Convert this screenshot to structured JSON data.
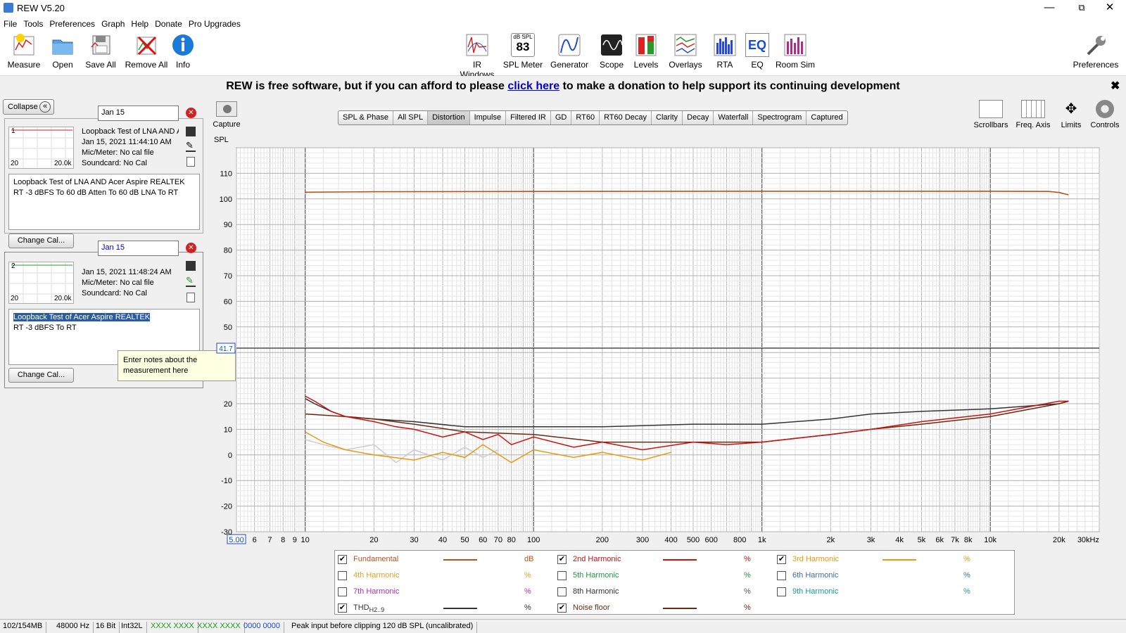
{
  "window": {
    "title": "REW V5.20"
  },
  "menu": [
    "File",
    "Tools",
    "Preferences",
    "Graph",
    "Help",
    "Donate",
    "Pro Upgrades"
  ],
  "toolbar_left": [
    "Measure",
    "Open",
    "Save All",
    "Remove All",
    "Info"
  ],
  "toolbar_center": [
    "IR Windows",
    "SPL Meter",
    "Generator",
    "Scope",
    "Levels",
    "Overlays",
    "RTA",
    "EQ",
    "Room Sim"
  ],
  "spl_meter_top": "dB SPL",
  "spl_meter_value": "83",
  "toolbar_right": "Preferences",
  "banner": {
    "pre": "REW is free software, but if you can afford to please ",
    "link": "click here",
    "post": " to make a donation to help support its continuing development"
  },
  "collapse_label": "Collapse",
  "measurements": [
    {
      "index": "1",
      "name_value": "Jan 15",
      "title": "Loopback Test of LNA AND Acer",
      "date": "Jan 15, 2021 11:44:10 AM",
      "mic": "Mic/Meter: No cal file",
      "soundcard": "Soundcard: No Cal",
      "thumb_lo": "20",
      "thumb_hi": "20.0k",
      "notes_line1": "Loopback Test of LNA AND Acer Aspire REALTEK",
      "notes_line2": "RT -3 dBFS To 60 dB Atten To 60 dB LNA To RT",
      "button": "Change Cal..."
    },
    {
      "index": "2",
      "name_value": "Jan 15",
      "title": "",
      "date": "Jan 15, 2021 11:48:24 AM",
      "mic": "Mic/Meter: No cal file",
      "soundcard": "Soundcard: No Cal",
      "thumb_lo": "20",
      "thumb_hi": "20.0k",
      "notes_line1": "Loopback Test of Acer Aspire REALTEK",
      "notes_line2": "RT -3 dBFS To RT",
      "button": "Change Cal..."
    }
  ],
  "tooltip": "Enter notes about the measurement here",
  "capture_label": "Capture",
  "tabs": [
    "SPL & Phase",
    "All SPL",
    "Distortion",
    "Impulse",
    "Filtered IR",
    "GD",
    "RT60",
    "RT60 Decay",
    "Clarity",
    "Decay",
    "Waterfall",
    "Spectrogram",
    "Captured"
  ],
  "selected_tab": "Distortion",
  "right_tools": [
    "Scrollbars",
    "Freq. Axis",
    "Limits",
    "Controls"
  ],
  "chart_data": {
    "type": "line",
    "ylabel": "SPL",
    "ylim": [
      -30,
      120
    ],
    "yticks": [
      110,
      100,
      90,
      80,
      70,
      60,
      50,
      20,
      10,
      0,
      -10,
      -20,
      -30
    ],
    "cursor_y": 41.7,
    "cursor_y_label": "41.7",
    "xlim": [
      5,
      30000
    ],
    "xscale": "log",
    "xtick_labels": [
      [
        "5.00",
        5
      ],
      [
        "6",
        6
      ],
      [
        "7",
        7
      ],
      [
        "8",
        8
      ],
      [
        "9",
        9
      ],
      [
        "10",
        10
      ],
      [
        "20",
        20
      ],
      [
        "30",
        30
      ],
      [
        "40",
        40
      ],
      [
        "50",
        50
      ],
      [
        "60",
        60
      ],
      [
        "70",
        70
      ],
      [
        "80",
        80
      ],
      [
        "100",
        100
      ],
      [
        "200",
        200
      ],
      [
        "300",
        300
      ],
      [
        "400",
        400
      ],
      [
        "500",
        500
      ],
      [
        "600",
        600
      ],
      [
        "800",
        800
      ],
      [
        "1k",
        1000
      ],
      [
        "2k",
        2000
      ],
      [
        "3k",
        3000
      ],
      [
        "4k",
        4000
      ],
      [
        "5k",
        5000
      ],
      [
        "6k",
        6000
      ],
      [
        "7k",
        7000
      ],
      [
        "8k",
        8000
      ],
      [
        "10k",
        10000
      ],
      [
        "20k",
        20000
      ],
      [
        "30kHz",
        30000
      ]
    ],
    "series": [
      {
        "name": "Fundamental",
        "color": "#b5541c",
        "unit": "dB",
        "checked": true,
        "x": [
          10,
          20,
          100,
          1000,
          10000,
          18000,
          20000,
          22000
        ],
        "y": [
          102.6,
          102.8,
          102.9,
          103,
          103,
          102.9,
          102.5,
          101.6
        ]
      },
      {
        "name": "2nd Harmonic",
        "color": "#cc1111",
        "unit": "%",
        "checked": true,
        "x": [
          10,
          11,
          13,
          15,
          20,
          25,
          30,
          40,
          50,
          60,
          70,
          80,
          100,
          150,
          200,
          300,
          500,
          700,
          1000,
          2000,
          3000,
          5000,
          10000,
          20000,
          22000
        ],
        "y": [
          23,
          21,
          17,
          15,
          13,
          11,
          10,
          7,
          9,
          6,
          8,
          4,
          7,
          3,
          5,
          2,
          5,
          4,
          5,
          8,
          10,
          13,
          16,
          21,
          21
        ]
      },
      {
        "name": "3rd Harmonic",
        "color": "#e89a10",
        "unit": "%",
        "checked": true,
        "x": [
          10,
          12,
          15,
          20,
          30,
          40,
          50,
          60,
          80,
          100,
          150,
          200,
          300,
          400
        ],
        "y": [
          9,
          5,
          2,
          0,
          -2,
          1,
          -1,
          4,
          -3,
          2,
          -1,
          1,
          -2,
          1
        ]
      },
      {
        "name": "4th Harmonic",
        "color": "#e8a020",
        "unit": "%",
        "checked": false
      },
      {
        "name": "5th Harmonic",
        "color": "#1a9a3a",
        "unit": "%",
        "checked": false
      },
      {
        "name": "6th Harmonic",
        "color": "#3a6ab0",
        "unit": "%",
        "checked": false
      },
      {
        "name": "7th Harmonic",
        "color": "#b030b0",
        "unit": "%",
        "checked": false
      },
      {
        "name": "8th Harmonic",
        "color": "#555555",
        "unit": "%",
        "checked": false
      },
      {
        "name": "9th Harmonic",
        "color": "#1a9a9a",
        "unit": "%",
        "checked": false
      },
      {
        "name": "THD",
        "sub": "H2..9",
        "color": "#333333",
        "unit": "%",
        "checked": true,
        "x": [
          10,
          11,
          13,
          15,
          20,
          30,
          50,
          100,
          200,
          500,
          1000,
          2000,
          3000,
          5000,
          10000,
          20000,
          22000
        ],
        "y": [
          22,
          20,
          17,
          15,
          14,
          13,
          11,
          11,
          11,
          12,
          12,
          14,
          16,
          17,
          18,
          20,
          21
        ]
      },
      {
        "name": "Noise floor",
        "color": "#6b2a10",
        "unit": "%",
        "checked": true,
        "x": [
          10,
          15,
          20,
          30,
          50,
          100,
          200,
          300,
          500,
          1000,
          2000,
          3000,
          5000,
          10000,
          20000,
          22000
        ],
        "y": [
          16,
          15,
          14,
          12,
          9,
          8,
          5,
          5,
          5,
          5,
          8,
          10,
          12,
          15,
          20,
          21
        ]
      },
      {
        "name": "grey trace",
        "color": "#cccccc",
        "x": [
          10,
          12,
          15,
          20,
          25,
          30,
          40,
          50,
          60,
          70
        ],
        "y": [
          6,
          4,
          2,
          4,
          -3,
          2,
          -2,
          3,
          -1,
          2
        ]
      }
    ]
  },
  "legend_rows": [
    [
      {
        "i": 0
      },
      {
        "i": 1
      },
      {
        "i": 2
      }
    ],
    [
      {
        "i": 3
      },
      {
        "i": 4
      },
      {
        "i": 5
      }
    ],
    [
      {
        "i": 6
      },
      {
        "i": 7
      },
      {
        "i": 8
      }
    ],
    [
      {
        "i": 9
      },
      {
        "i": 10
      }
    ]
  ],
  "status": [
    "102/154MB",
    "48000 Hz",
    "16 Bit",
    "Int32L",
    "XXXX XXXX",
    "XXXX XXXX",
    "0000 0000",
    "Peak input before clipping 120 dB SPL (uncalibrated)"
  ]
}
